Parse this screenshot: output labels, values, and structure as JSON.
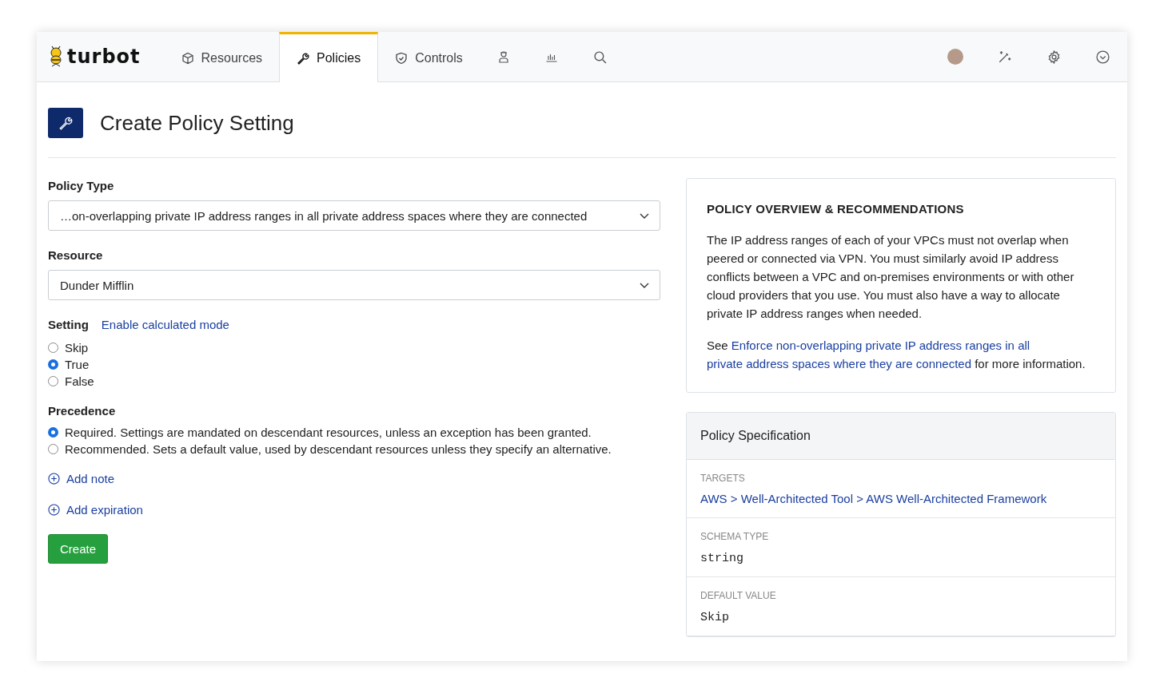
{
  "nav": {
    "logo": "turbot",
    "tabs": [
      {
        "label": "Resources",
        "selected": false
      },
      {
        "label": "Policies",
        "selected": true
      },
      {
        "label": "Controls",
        "selected": false
      }
    ]
  },
  "page_title": "Create Policy Setting",
  "form": {
    "policy_type": {
      "label": "Policy Type",
      "value": "…on-overlapping private IP address ranges in all private address spaces where they are connected"
    },
    "resource": {
      "label": "Resource",
      "value": "Dunder Mifflin"
    },
    "setting": {
      "label": "Setting",
      "link": "Enable calculated mode",
      "options": [
        {
          "label": "Skip",
          "selected": false
        },
        {
          "label": "True",
          "selected": true
        },
        {
          "label": "False",
          "selected": false
        }
      ]
    },
    "precedence": {
      "label": "Precedence",
      "options": [
        {
          "label": "Required. Settings are mandated on descendant resources, unless an exception has been granted.",
          "selected": true
        },
        {
          "label": "Recommended. Sets a default value, used by descendant resources unless they specify an alternative.",
          "selected": false
        }
      ]
    },
    "actions": [
      "Add note",
      "Add expiration"
    ],
    "submit": "Create"
  },
  "overview": {
    "title": "POLICY OVERVIEW & RECOMMENDATIONS",
    "text": "The IP address ranges of each of your VPCs must not overlap when peered or connected via VPN. You must similarly avoid IP address conflicts between a VPC and on-premises environments or with other cloud providers that you use. You must also have a way to allocate private IP address ranges when needed.",
    "see_prefix": "See",
    "see_link": [
      "Enforce non-overlapping private IP address ranges in all",
      "private address spaces where they are connected"
    ],
    "see_suffix": "for more information."
  },
  "specification": {
    "title": "Policy Specification",
    "sections": [
      {
        "label": "TARGETS",
        "kind": "link",
        "value": "AWS > Well-Architected Tool > AWS Well-Architected Framework"
      },
      {
        "label": "SCHEMA TYPE",
        "kind": "code",
        "value": "string"
      },
      {
        "label": "DEFAULT VALUE",
        "kind": "code",
        "value": "Skip"
      }
    ]
  }
}
